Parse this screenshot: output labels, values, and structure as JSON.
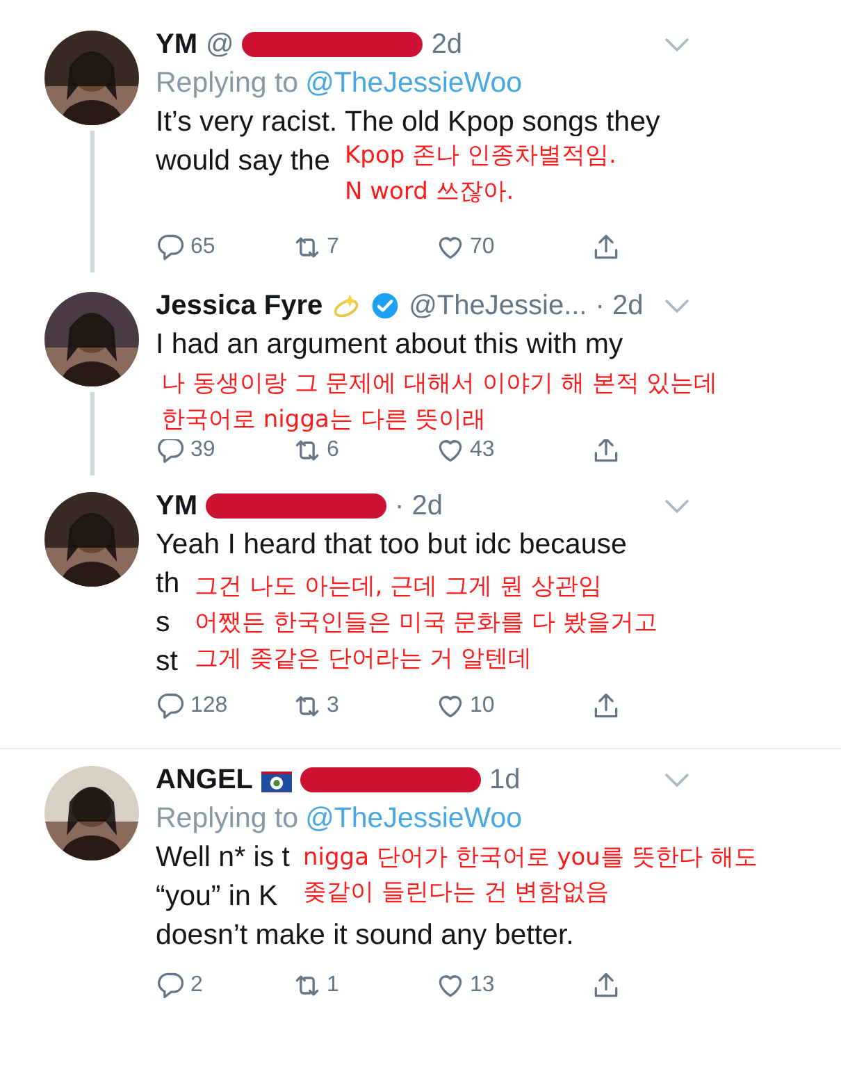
{
  "tweets": [
    {
      "name": "YM",
      "handle": "@",
      "redacted": true,
      "time": "2d",
      "replying_to": {
        "label": "Replying to",
        "mention": "@TheJessieWoo"
      },
      "lines": [
        "It’s very racist. The old Kpop songs they",
        "would say the"
      ],
      "overlay": [
        "Kpop 존나 인종차별적임.",
        "N word 쓰잖아."
      ],
      "thread": true,
      "actions": [
        {
          "kind": "reply",
          "count": "65"
        },
        {
          "kind": "retweet",
          "count": "7"
        },
        {
          "kind": "like",
          "count": "70"
        },
        {
          "kind": "share"
        }
      ]
    },
    {
      "name": "Jessica Fyre",
      "badges": [
        {
          "kind": "sparkle"
        },
        {
          "kind": "verified"
        }
      ],
      "handle": "@TheJessie...",
      "redacted": false,
      "time": "· 2d",
      "lines": [
        "I had an argument about this with my"
      ],
      "overlay": [
        "나 동생이랑 그 문제에 대해서 이야기 해 본적 있는데",
        "한국어로 nigga는 다른 뜻이래"
      ],
      "thread": true,
      "actions": [
        {
          "kind": "reply",
          "count": "39"
        },
        {
          "kind": "retweet",
          "count": "6"
        },
        {
          "kind": "like",
          "count": "43"
        },
        {
          "kind": "share"
        }
      ]
    },
    {
      "name": "YM",
      "redacted": true,
      "time": "· 2d",
      "lines": [
        "Yeah I heard that too but idc because",
        "th",
        "s",
        "st"
      ],
      "overlay": [
        "그건 나도 아는데, 근데 그게 뭔 상관임",
        "어쨌든 한국인들은 미국 문화를 다 봤을거고",
        "그게 좆같은 단어라는 거 알텐데"
      ],
      "thread": false,
      "actions": [
        {
          "kind": "reply",
          "count": "128"
        },
        {
          "kind": "retweet",
          "count": "3"
        },
        {
          "kind": "like",
          "count": "10"
        },
        {
          "kind": "share"
        }
      ]
    },
    {
      "name": "ANGEL",
      "badges": [
        {
          "kind": "flag"
        }
      ],
      "redacted": true,
      "time": "1d",
      "replying_to": {
        "label": "Replying to",
        "mention": "@TheJessieWoo"
      },
      "lines": [
        "Well n* is t",
        "“you” in K",
        "doesn’t make it sound any better."
      ],
      "overlay": [
        "nigga 단어가 한국어로 you를 뜻한다 해도",
        "좆같이 들린다는 건 변함없음"
      ],
      "thread": false,
      "actions": [
        {
          "kind": "reply",
          "count": "2"
        },
        {
          "kind": "retweet",
          "count": "1"
        },
        {
          "kind": "like",
          "count": "13"
        },
        {
          "kind": "share"
        }
      ]
    }
  ]
}
